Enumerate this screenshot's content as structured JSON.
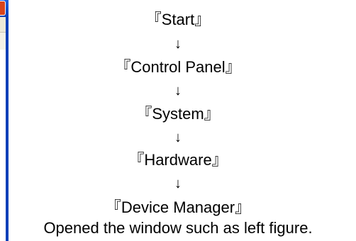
{
  "steps": [
    {
      "label": "『Start』"
    },
    {
      "label": "『Control Panel』"
    },
    {
      "label": "『System』"
    },
    {
      "label": "『Hardware』"
    },
    {
      "label": "『Device Manager』"
    }
  ],
  "arrow_glyph": "↓",
  "caption": "Opened the window such as left figure.",
  "colors": {
    "window_titlebar": "#0a3fb8",
    "window_close_button": "#d9451c",
    "window_menubar": "#ece9d8"
  },
  "icons": {
    "close": "close-icon"
  }
}
